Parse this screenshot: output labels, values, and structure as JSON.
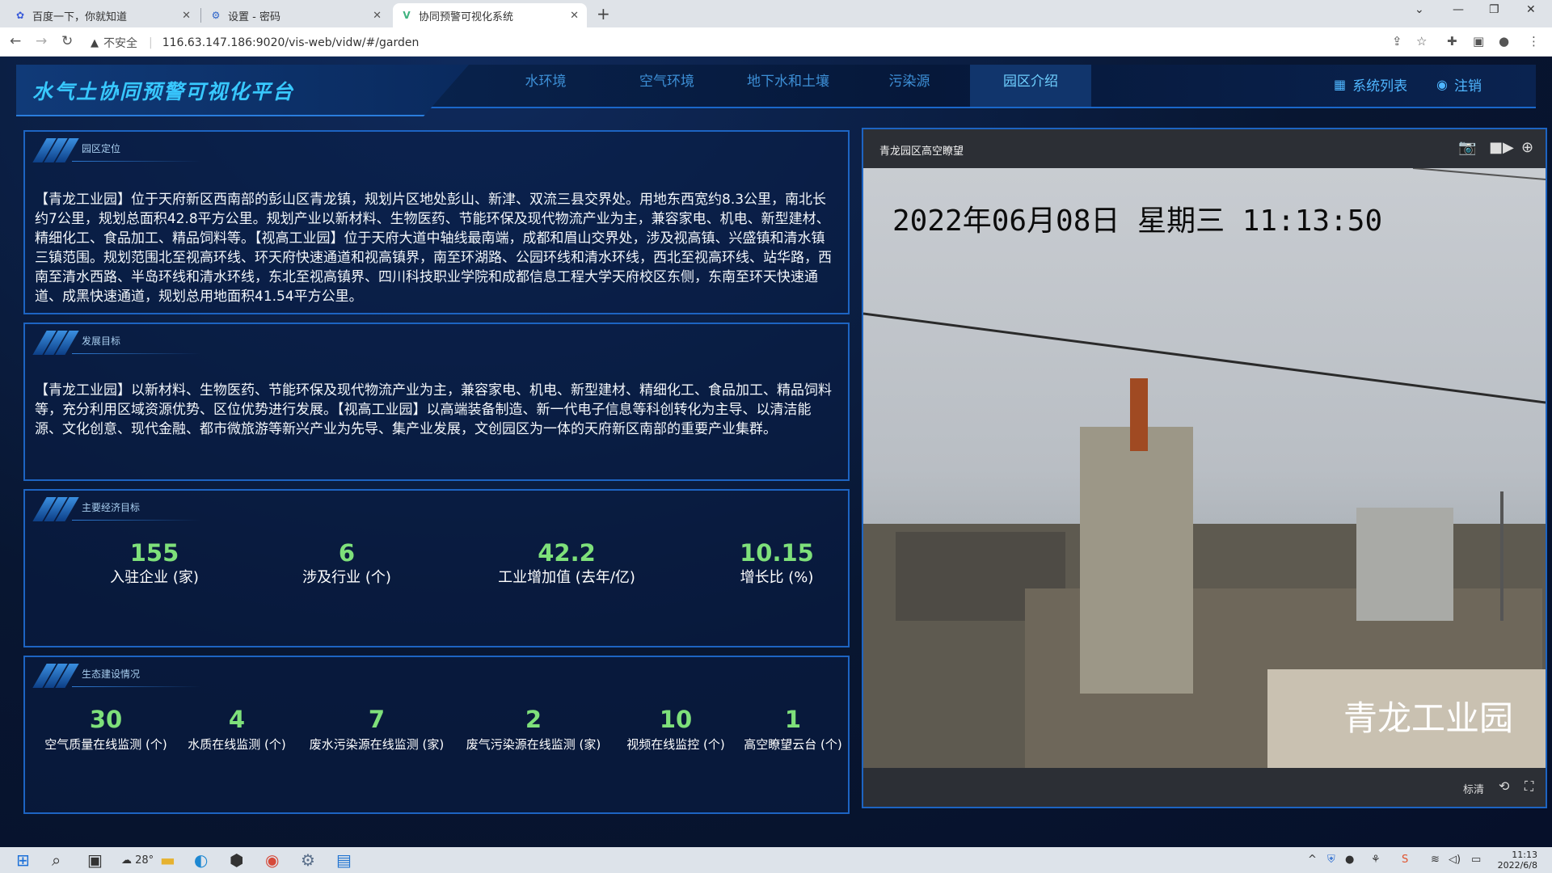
{
  "browser": {
    "tabs": [
      {
        "title": "百度一下，你就知道",
        "favicon": "baidu-paw-icon"
      },
      {
        "title": "设置 - 密码",
        "favicon": "gear-icon"
      },
      {
        "title": "协同预警可视化系统",
        "favicon": "vue-logo-icon"
      }
    ],
    "security_label": "不安全",
    "url": "116.63.147.186:9020/vis-web/vidw/#/garden"
  },
  "app": {
    "title": "水气土协同预警可视化平台",
    "menu": [
      "水环境",
      "空气环境",
      "地下水和土壤",
      "污染源",
      "园区介绍"
    ],
    "active_menu": "园区介绍",
    "system_list": "系统列表",
    "logout": "注销"
  },
  "panels": {
    "location": {
      "title": "园区定位",
      "text": "【青龙工业园】位于天府新区西南部的彭山区青龙镇，规划片区地处彭山、新津、双流三县交界处。用地东西宽约8.3公里，南北长约7公里，规划总面积42.8平方公里。规划产业以新材料、生物医药、节能环保及现代物流产业为主，兼容家电、机电、新型建材、精细化工、食品加工、精品饲料等。【视高工业园】位于天府大道中轴线最南端，成都和眉山交界处，涉及视高镇、兴盛镇和清水镇三镇范围。规划范围北至视高环线、环天府快速通道和视高镇界，南至环湖路、公园环线和清水环线，西北至视高环线、站华路，西南至清水西路、半岛环线和清水环线，东北至视高镇界、四川科技职业学院和成都信息工程大学天府校区东侧，东南至环天快速通道、成黑快速通道，规划总用地面积41.54平方公里。"
    },
    "goals": {
      "title": "发展目标",
      "text": "【青龙工业园】以新材料、生物医药、节能环保及现代物流产业为主，兼容家电、机电、新型建材、精细化工、食品加工、精品饲料等，充分利用区域资源优势、区位优势进行发展。【视高工业园】以高端装备制造、新一代电子信息等科创转化为主导、以清洁能源、文化创意、现代金融、都市微旅游等新兴产业为先导、集产业发展，文创园区为一体的天府新区南部的重要产业集群。"
    },
    "economy": {
      "title": "主要经济目标",
      "stats": [
        {
          "value": "155",
          "label": "入驻企业 (家)"
        },
        {
          "value": "6",
          "label": "涉及行业 (个)"
        },
        {
          "value": "42.2",
          "label": "工业增加值 (去年/亿)"
        },
        {
          "value": "10.15",
          "label": "增长比 (%)"
        }
      ]
    },
    "ecology": {
      "title": "生态建设情况",
      "stats": [
        {
          "value": "30",
          "label": "空气质量在线监测 (个)"
        },
        {
          "value": "4",
          "label": "水质在线监测 (个)"
        },
        {
          "value": "7",
          "label": "废水污染源在线监测 (家)"
        },
        {
          "value": "2",
          "label": "废气污染源在线监测 (家)"
        },
        {
          "value": "10",
          "label": "视频在线监控 (个)"
        },
        {
          "value": "1",
          "label": "高空瞭望云台 (个)"
        }
      ]
    }
  },
  "video": {
    "title": "青龙园区高空瞭望",
    "osd_time": "2022年06月08日  星期三  11:13:50",
    "osd_name": "青龙工业园",
    "quality": "标清"
  },
  "taskbar": {
    "weather": "28°",
    "time": "11:13",
    "date": "2022/6/8"
  }
}
